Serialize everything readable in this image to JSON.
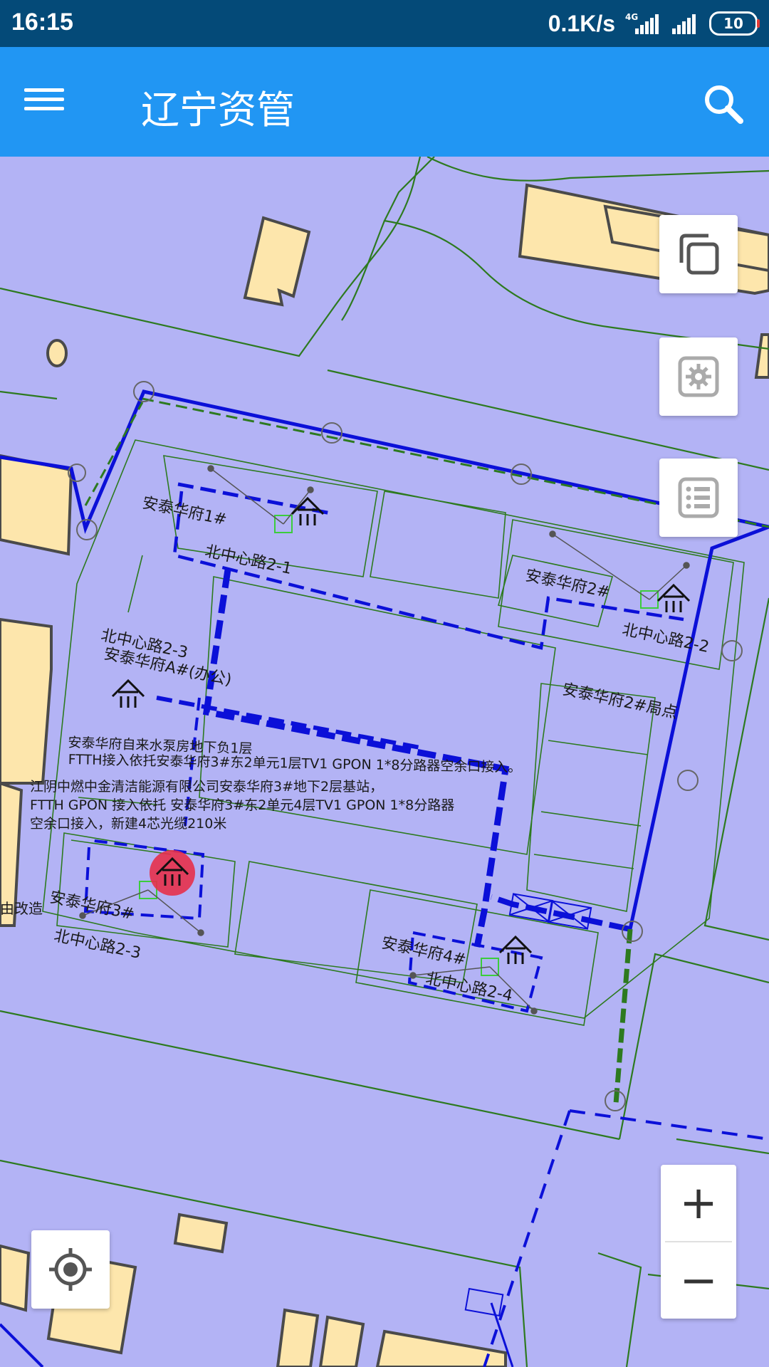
{
  "status_bar": {
    "time": "16:15",
    "net_speed": "0.1K/s",
    "network_type": "4G",
    "battery": "10"
  },
  "app_bar": {
    "title": "辽宁资管",
    "menu_icon": "menu-icon",
    "search_icon": "search-icon"
  },
  "map": {
    "labels": {
      "b1_name": "安泰华府1#",
      "b1_road": "北中心路2-1",
      "b2_name": "安泰华府2#",
      "b2_road": "北中心路2-2",
      "b2_node": "安泰华府2#局点",
      "b3_road_top": "北中心路2-3",
      "b3a_name": "安泰华府A#(办公)",
      "b3_name": "安泰华府3#",
      "b3_road": "北中心路2-3",
      "b4_name": "安泰华府4#",
      "b4_road": "北中心路2-4",
      "left_edge": "由改造",
      "note_1": "安泰华府自来水泵房地下负1层",
      "note_2": "FTTH接入依托安泰华府3#东2单元1层TV1 GPON 1*8分路器空余口接入。",
      "note_3": "江阴中燃中金清洁能源有限公司安泰华府3#地下2层基站，",
      "note_4": "FTTH GPON 接入依托 安泰华府3#东2单元4层TV1 GPON 1*8分路器",
      "note_5": "空余口接入，新建4芯光缆210米"
    }
  },
  "side_tools": {
    "copy_icon": "copy-layers-icon",
    "settings_icon": "gear-icon",
    "list_icon": "list-icon"
  },
  "zoom": {
    "in_label": "+",
    "out_label": "−"
  },
  "locate": {
    "icon": "my-location-icon"
  },
  "colors": {
    "status_bar": "#044a78",
    "app_bar": "#2196f3",
    "map_bg": "#b3b3f5",
    "building": "#fde6ac",
    "cable": "#0b10d8",
    "green_line": "#2d7a1f",
    "selected": "#e5304b"
  }
}
